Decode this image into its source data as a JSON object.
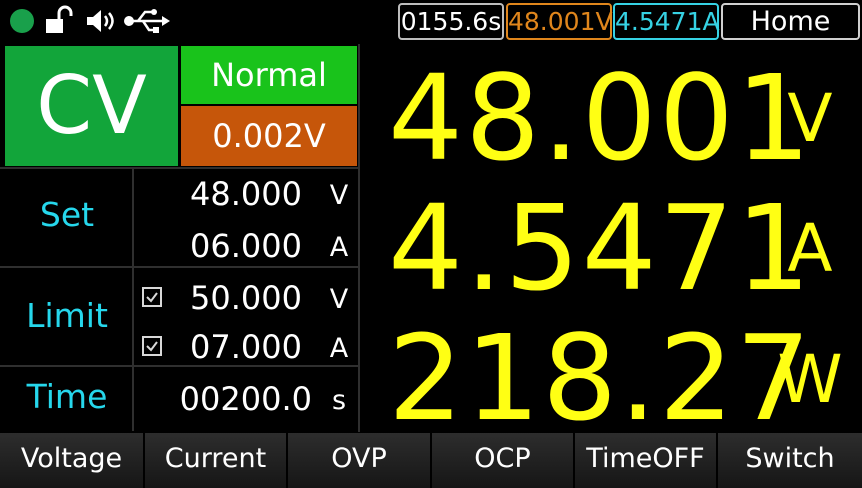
{
  "status": {
    "icons": [
      "status-dot",
      "lock-open-icon",
      "speaker-icon",
      "usb-icon"
    ],
    "timer": "0155.6s",
    "voltage_pill": "48.001V",
    "current_pill": "4.5471A",
    "home_label": "Home"
  },
  "mode": {
    "label": "CV",
    "state": "Normal",
    "ripple": "0.002V"
  },
  "set": {
    "label": "Set",
    "voltage": "48.000",
    "voltage_unit": "V",
    "current": "06.000",
    "current_unit": "A"
  },
  "limit": {
    "label": "Limit",
    "voltage": "50.000",
    "voltage_unit": "V",
    "voltage_checked": true,
    "current": "07.000",
    "current_unit": "A",
    "current_checked": true
  },
  "time": {
    "label": "Time",
    "value": "00200.0",
    "unit": "s"
  },
  "readings": {
    "voltage": "48.001",
    "voltage_unit": "V",
    "current": "4.5471",
    "current_unit": "A",
    "power": "218.27",
    "power_unit": "W"
  },
  "softkeys": [
    "Voltage",
    "Current",
    "OVP",
    "OCP",
    "TimeOFF",
    "Switch"
  ],
  "colors": {
    "reading": "#ffff14",
    "label": "#26d7ec",
    "cv_bg": "#12a53a",
    "normal_bg": "#19c31b",
    "ripple_bg": "#c6560a",
    "voltage_accent": "#e0861c",
    "current_accent": "#36d2e4"
  }
}
